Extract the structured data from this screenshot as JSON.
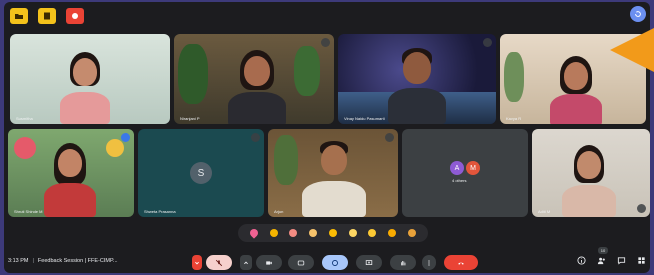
{
  "colors": {
    "frame": "#3d3a7a",
    "meet_bg": "#1c1c1f",
    "end_call": "#ea4335",
    "accent_blue": "#a8c7fa",
    "arrow": "#f29a1a"
  },
  "top_icons": [
    "folder-icon",
    "notes-icon",
    "record-icon"
  ],
  "tiles": [
    {
      "name": "Susmitha",
      "type": "video"
    },
    {
      "name": "Niranjani P",
      "type": "video"
    },
    {
      "name": "Vinay Naidu Pasumarti",
      "type": "video"
    },
    {
      "name": "Kavya R",
      "type": "video"
    },
    {
      "name": "Shruti Shinde M",
      "type": "video"
    },
    {
      "name": "Shweta Prasanna",
      "type": "avatar",
      "initial": "S"
    },
    {
      "name": "Arjun",
      "type": "video"
    },
    {
      "name": "4 others",
      "type": "others",
      "initials": [
        "A",
        "M"
      ]
    },
    {
      "name": "Aditi M",
      "type": "video"
    }
  ],
  "reactions": [
    "heart",
    "thumbs-up",
    "party",
    "clap",
    "laugh",
    "surprised",
    "sad",
    "thinking",
    "thumbs-down"
  ],
  "meeting": {
    "time": "3:13 PM",
    "separator": "|",
    "title": "Feedback Session | FFE-CIMP..."
  },
  "controls": [
    "hand-down-icon",
    "mic-off-icon",
    "chevron-icon",
    "camera-icon",
    "captions-icon",
    "present-icon",
    "emoji-icon",
    "raise-hand-icon",
    "more-icon",
    "end-call-icon"
  ],
  "right_icons": [
    "info-icon",
    "people-icon",
    "chat-icon",
    "activities-icon"
  ],
  "people_count": "10"
}
